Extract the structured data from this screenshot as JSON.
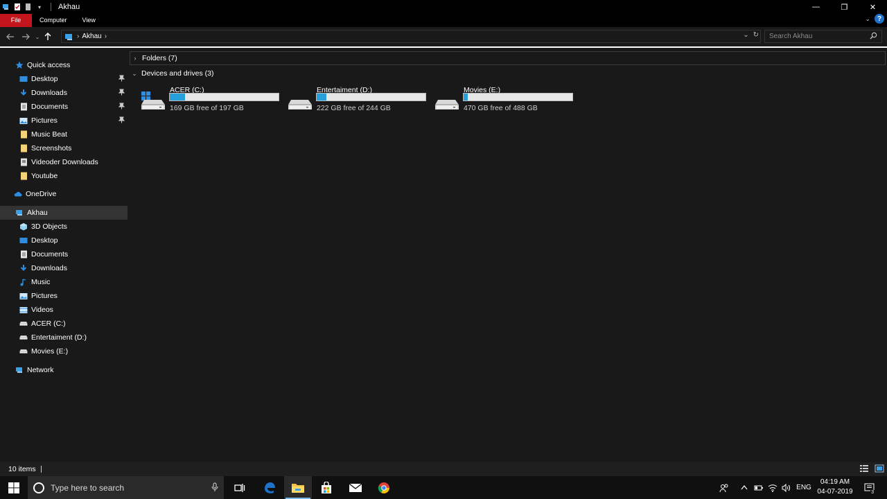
{
  "window": {
    "title": "Akhau",
    "minimize_glyph": "—",
    "restore_glyph": "❐",
    "close_glyph": "✕"
  },
  "ribbon": {
    "tabs": [
      "File",
      "Computer",
      "View"
    ]
  },
  "address": {
    "crumbs": [
      "Akhau"
    ]
  },
  "search": {
    "placeholder": "Search Akhau"
  },
  "nav": {
    "quick_access": "Quick access",
    "quick_items": [
      {
        "label": "Desktop",
        "icon": "desktop-icon",
        "pinned": true
      },
      {
        "label": "Downloads",
        "icon": "downloads-icon",
        "pinned": true
      },
      {
        "label": "Documents",
        "icon": "documents-icon",
        "pinned": true
      },
      {
        "label": "Pictures",
        "icon": "pictures-icon",
        "pinned": true
      },
      {
        "label": "Music Beat",
        "icon": "folder-icon",
        "pinned": false
      },
      {
        "label": "Screenshots",
        "icon": "folder-icon",
        "pinned": false
      },
      {
        "label": "Videoder Downloads",
        "icon": "file-icon",
        "pinned": false
      },
      {
        "label": "Youtube",
        "icon": "folder-icon",
        "pinned": false
      }
    ],
    "onedrive": "OneDrive",
    "this_pc": "Akhau",
    "pc_items": [
      {
        "label": "3D Objects",
        "icon": "3d-objects-icon"
      },
      {
        "label": "Desktop",
        "icon": "desktop-icon"
      },
      {
        "label": "Documents",
        "icon": "documents-icon"
      },
      {
        "label": "Downloads",
        "icon": "downloads-icon"
      },
      {
        "label": "Music",
        "icon": "music-icon"
      },
      {
        "label": "Pictures",
        "icon": "pictures-icon"
      },
      {
        "label": "Videos",
        "icon": "videos-icon"
      },
      {
        "label": "ACER (C:)",
        "icon": "drive-icon"
      },
      {
        "label": "Entertaiment (D:)",
        "icon": "drive-icon"
      },
      {
        "label": "Movies (E:)",
        "icon": "drive-icon"
      }
    ],
    "network": "Network"
  },
  "content": {
    "folders_group": "Folders (7)",
    "devices_group": "Devices and drives (3)",
    "drives": [
      {
        "name": "ACER (C:)",
        "free": "169 GB free of 197 GB",
        "used_fraction": 0.14,
        "windows": true
      },
      {
        "name": "Entertaiment (D:)",
        "free": "222 GB free of 244 GB",
        "used_fraction": 0.09,
        "windows": false
      },
      {
        "name": "Movies (E:)",
        "free": "470 GB free of 488 GB",
        "used_fraction": 0.04,
        "windows": false
      }
    ]
  },
  "status": {
    "items": "10 items"
  },
  "taskbar": {
    "search_placeholder": "Type here to search",
    "lang": "ENG",
    "time": "04:19 AM",
    "date": "04-07-2019",
    "notification_count": "3"
  },
  "colors": {
    "accent": "#26a0da",
    "file_tab": "#c4151c",
    "background": "#191919"
  }
}
